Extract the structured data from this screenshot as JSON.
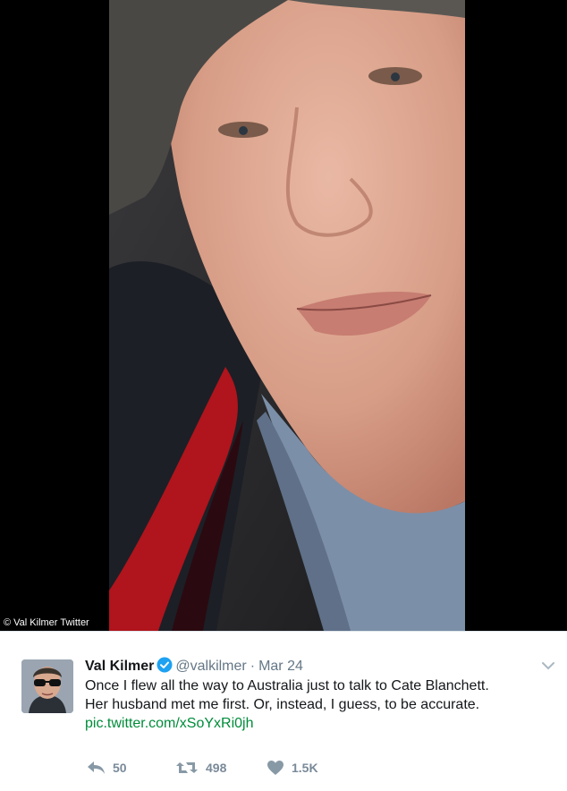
{
  "tweet": {
    "display_name": "Val Kilmer",
    "handle": "@valkilmer",
    "separator": "·",
    "date": "Mar 24",
    "text_lines": [
      "Once I flew all the way to Australia just to talk to Cate Blanchett.",
      "Her husband met me first. Or, instead, I guess, to be accurate."
    ],
    "link_text": "pic.twitter.com/xSoYxRi0jh",
    "actions": {
      "reply_count": "50",
      "retweet_count": "498",
      "like_count": "1.5K"
    }
  },
  "photo_credit": "© Val Kilmer Twitter",
  "colors": {
    "verified_badge": "#1da1f2",
    "link": "#008c3a",
    "action_icon": "#8899a6"
  },
  "icons": {
    "verified": "verified-badge-icon",
    "more": "chevron-down-icon",
    "reply": "reply-icon",
    "retweet": "retweet-icon",
    "like": "heart-icon"
  }
}
